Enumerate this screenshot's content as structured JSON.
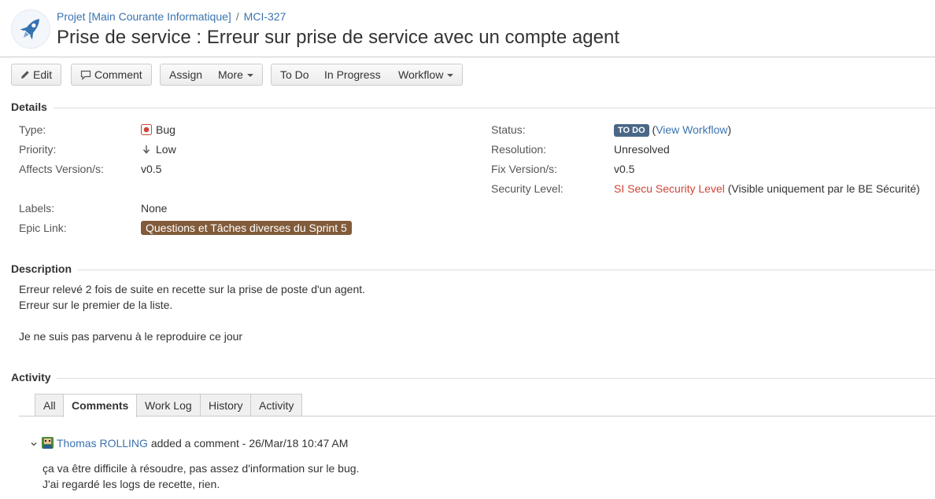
{
  "breadcrumb": {
    "project": "Projet [Main Courante Informatique]",
    "separator": "/",
    "issue_key": "MCI-327"
  },
  "title": "Prise de service : Erreur sur prise de service avec un compte agent",
  "toolbar": {
    "edit": "Edit",
    "comment": "Comment",
    "assign": "Assign",
    "more": "More",
    "todo": "To Do",
    "in_progress": "In Progress",
    "workflow": "Workflow"
  },
  "details": {
    "heading": "Details",
    "type_label": "Type:",
    "type_value": "Bug",
    "priority_label": "Priority:",
    "priority_value": "Low",
    "affects_label": "Affects Version/s:",
    "affects_value": "v0.5",
    "labels_label": "Labels:",
    "labels_value": "None",
    "epic_label": "Epic Link:",
    "epic_value": "Questions et Tâches diverses du Sprint 5",
    "status_label": "Status:",
    "status_value": "TO DO",
    "status_open": "(",
    "status_link": "View Workflow",
    "status_close": ")",
    "resolution_label": "Resolution:",
    "resolution_value": "Unresolved",
    "fix_label": "Fix Version/s:",
    "fix_value": "v0.5",
    "security_label": "Security Level:",
    "security_value": "SI Secu Security Level",
    "security_note": "(Visible uniquement par le BE Sécurité)"
  },
  "description": {
    "heading": "Description",
    "line1": "Erreur relevé 2 fois de suite en recette sur la prise de poste d'un agent.",
    "line2": "Erreur sur le premier de la liste.",
    "line3": "Je ne suis pas parvenu à le reproduire ce jour"
  },
  "activity": {
    "heading": "Activity",
    "tabs": [
      "All",
      "Comments",
      "Work Log",
      "History",
      "Activity"
    ],
    "active_tab": "Comments"
  },
  "comment": {
    "author": "Thomas ROLLING",
    "action": "added a comment - 26/Mar/18 10:47 AM",
    "line1": "ça va être difficile à résoudre, pas assez d'information sur le bug.",
    "line2": "J'ai regardé les logs de recette, rien."
  },
  "colors": {
    "link": "#3b73af",
    "status_lozenge": "#4a6785",
    "epic": "#815b3a",
    "security": "#d04437",
    "bug_icon": "#d04437"
  },
  "icons": [
    "project-rocket-icon",
    "pencil-icon",
    "comment-icon",
    "bug-icon",
    "arrow-down-icon",
    "chevron-down-icon",
    "user-avatar-icon"
  ]
}
